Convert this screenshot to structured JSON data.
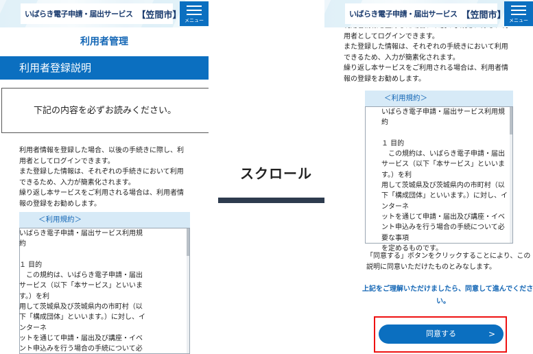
{
  "header": {
    "title": "いばらき電子申請・届出サービス",
    "city": "【笠間市】",
    "menu_label": "メニュー"
  },
  "page_title": "利用者管理",
  "section_title": "利用者登録説明",
  "notice": "下記の内容を必ずお読みください。",
  "description_lines": [
    "利用者情報を登録した場合、以後の手続きに際し、利",
    "用者としてログインできます。",
    "また登録した情報は、それぞれの手続きにおいて利用",
    "できるため、入力が簡素化されます。",
    "繰り返し本サービスをご利用される場合は、利用者情",
    "報の登録をお勧めします。"
  ],
  "terms": {
    "header": "＜利用規約＞",
    "lines": [
      "いばらき電子申請・届出サービス利用規",
      "約",
      "",
      "１ 目的",
      "　この規約は、いばらき電子申請・届出",
      "サービス（以下「本サービス」といいま",
      "す。）を利",
      "用して茨城県及び茨城県内の市町村（以",
      "下「構成団体」といいます。）に対し、イ",
      "ンターネ",
      "ットを通じて申請・届出及び講座・イベ",
      "ント申込みを行う場合の手続について必",
      "要な事項",
      "を定めるものです。"
    ]
  },
  "agree_note_lines": [
    "「同意する」ボタンをクリックすることにより、この",
    "説明に同意いただけたものとみなします。"
  ],
  "agree_prompt_lines": [
    "上記をご理解いただけましたら、同意して進んでくださ",
    "い。"
  ],
  "agree_button": "同意する",
  "agree_chevron": ">",
  "scroll_label": "スクロール",
  "colors": {
    "primary": "#0b6fc0",
    "title_blue": "#1366b5",
    "terms_header_bg": "#d7eaf7",
    "highlight": "#e11111",
    "arrow": "#2d3b4e"
  }
}
